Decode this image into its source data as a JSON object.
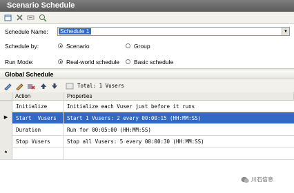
{
  "window": {
    "title": "Scenario Schedule"
  },
  "toolbar": {
    "icons": [
      "new-schedule-icon",
      "delete-icon",
      "rename-icon",
      "duplicate-icon"
    ]
  },
  "form": {
    "schedule_name_label": "Schedule Name:",
    "schedule_name_value": "Schedule 1",
    "schedule_by_label": "Schedule by:",
    "schedule_by_options": [
      "Scenario",
      "Group"
    ],
    "schedule_by_selected": "Scenario",
    "run_mode_label": "Run Mode:",
    "run_mode_options": [
      "Real-world schedule",
      "Basic schedule"
    ],
    "run_mode_selected": "Real-world schedule"
  },
  "global_schedule": {
    "title": "Global Schedule",
    "total_label": "Total: 1 Vusers",
    "columns": [
      "Action",
      "Properties"
    ],
    "rows": [
      {
        "action": "Initialize",
        "properties": "Initialize each Vuser just before it runs"
      },
      {
        "action": "Start  Vusers",
        "properties": "Start 1 Vusers: 2 every 00:00:15 (HH:MM:SS)",
        "selected": true
      },
      {
        "action": "Duration",
        "properties": "Run for 00:05:00 (HH:MM:SS)"
      },
      {
        "action": "Stop Vusers",
        "properties": "Stop all Vusers: 5 every 00:00:30 (HH:MM:SS)"
      }
    ],
    "new_row_marker": "*",
    "selected_row_marker": "▶"
  },
  "watermark": {
    "text": "川石信息"
  },
  "colors": {
    "selection": "#316ac5",
    "titlebar": "#6b6b6b"
  }
}
